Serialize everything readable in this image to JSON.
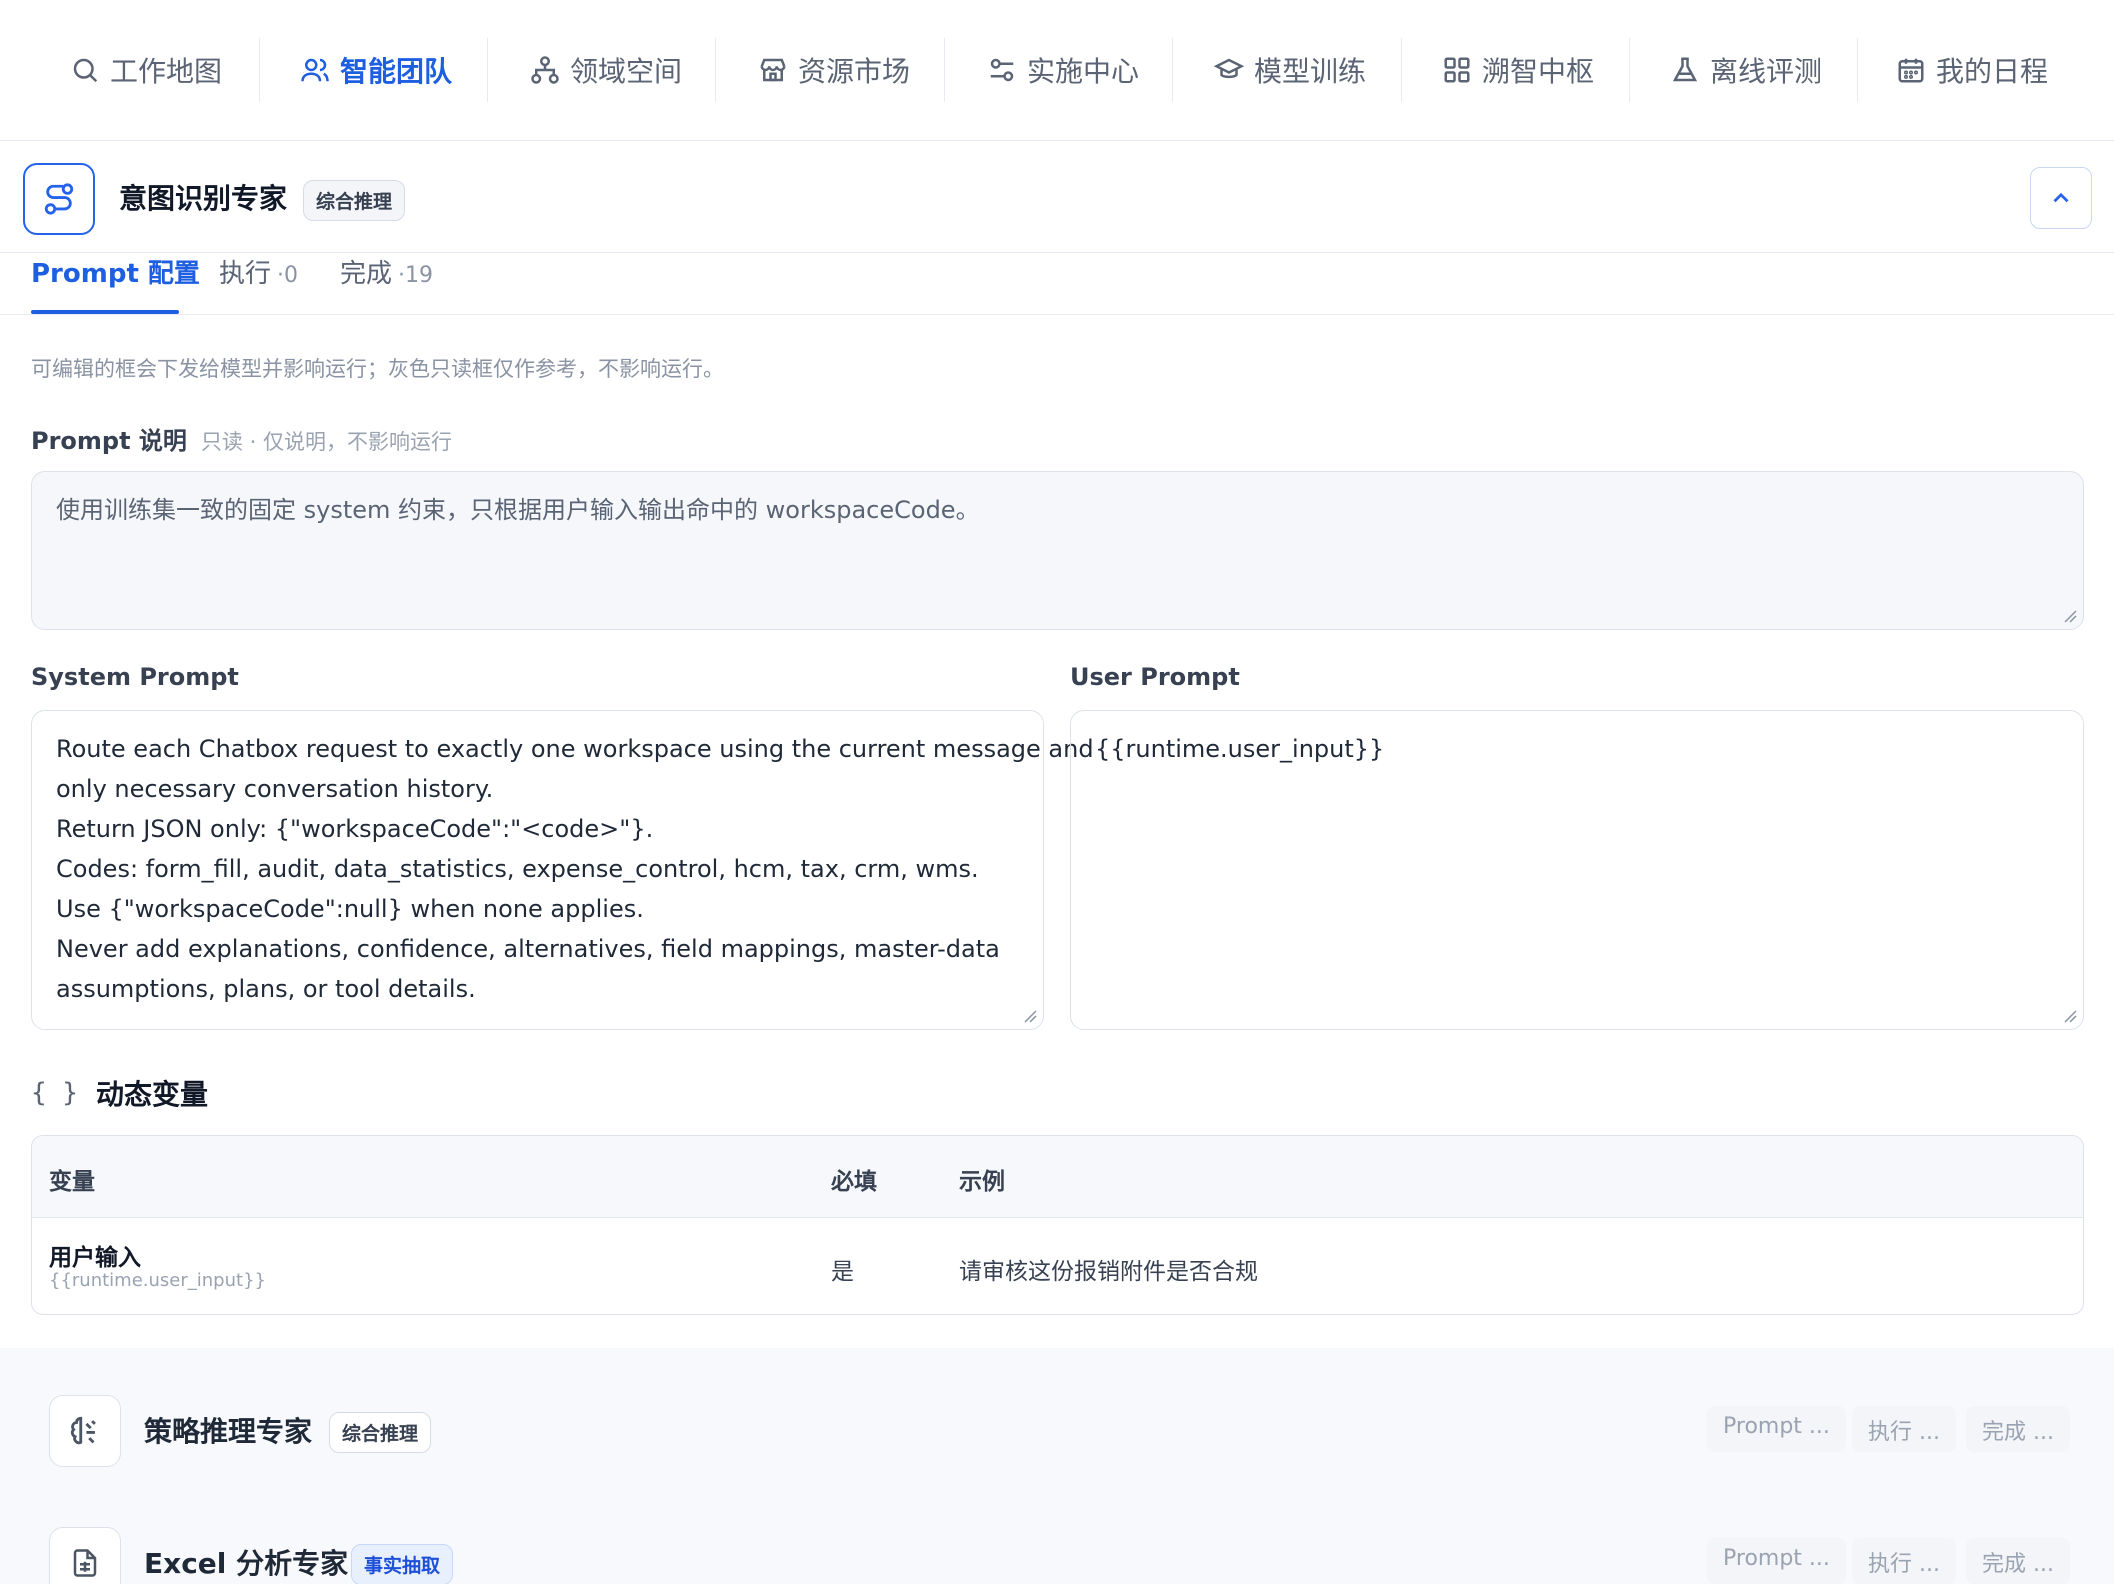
{
  "nav": {
    "items": [
      {
        "label": "工作地图",
        "icon": "search-icon",
        "active": false
      },
      {
        "label": "智能团队",
        "icon": "users-icon",
        "active": true
      },
      {
        "label": "领域空间",
        "icon": "sitemap-icon",
        "active": false
      },
      {
        "label": "资源市场",
        "icon": "store-icon",
        "active": false
      },
      {
        "label": "实施中心",
        "icon": "sliders-icon",
        "active": false
      },
      {
        "label": "模型训练",
        "icon": "graduation-cap-icon",
        "active": false
      },
      {
        "label": "溯智中枢",
        "icon": "grid-icon",
        "active": false
      },
      {
        "label": "离线评测",
        "icon": "flask-icon",
        "active": false
      },
      {
        "label": "我的日程",
        "icon": "calendar-icon",
        "active": false
      }
    ]
  },
  "expert": {
    "title": "意图识别专家",
    "badge": "综合推理",
    "icon": "route-icon"
  },
  "tabs": [
    {
      "label": "Prompt 配置",
      "count": ""
    },
    {
      "label": "执行",
      "count": "·0"
    },
    {
      "label": "完成",
      "count": "·19"
    }
  ],
  "hint": "可编辑的框会下发给模型并影响运行；灰色只读框仅作参考，不影响运行。",
  "prompt_desc": {
    "label": "Prompt 说明",
    "sub": "只读 · 仅说明，不影响运行",
    "text": "使用训练集一致的固定 system 约束，只根据用户输入输出命中的 workspaceCode。"
  },
  "system_prompt": {
    "label": "System Prompt",
    "lines": [
      "Route each Chatbox request to exactly one workspace using the current message and",
      "only necessary conversation history.",
      "Return JSON only: {\"workspaceCode\":\"<code>\"}.",
      "Codes: form_fill, audit, data_statistics, expense_control, hcm, tax, crm, wms.",
      "Use {\"workspaceCode\":null} when none applies.",
      "Never add explanations, confidence, alternatives, field mappings, master-data",
      "assumptions, plans, or tool details."
    ]
  },
  "user_prompt": {
    "label": "User Prompt",
    "text": "{{runtime.user_input}}"
  },
  "dynamic_vars": {
    "title": "动态变量",
    "headers": {
      "variable": "变量",
      "required": "必填",
      "example": "示例"
    },
    "rows": [
      {
        "name": "用户输入",
        "key": "{{runtime.user_input}}",
        "required": "是",
        "example": "请审核这份报销附件是否合规"
      }
    ]
  },
  "other_experts": [
    {
      "name": "策略推理专家",
      "badge": "综合推理",
      "badge_style": "gray",
      "icon": "brain-icon",
      "tabs": [
        "Prompt ...",
        "执行 ...",
        "完成 ..."
      ]
    },
    {
      "name": "Excel 分析专家",
      "badge": "事实抽取",
      "badge_style": "blue",
      "icon": "spreadsheet-file-icon",
      "tabs": [
        "Prompt ...",
        "执行 ...",
        "完成 ..."
      ]
    }
  ],
  "colors": {
    "accent": "#1d5fe0",
    "border": "#dde2ea",
    "muted": "#8a93a3"
  }
}
